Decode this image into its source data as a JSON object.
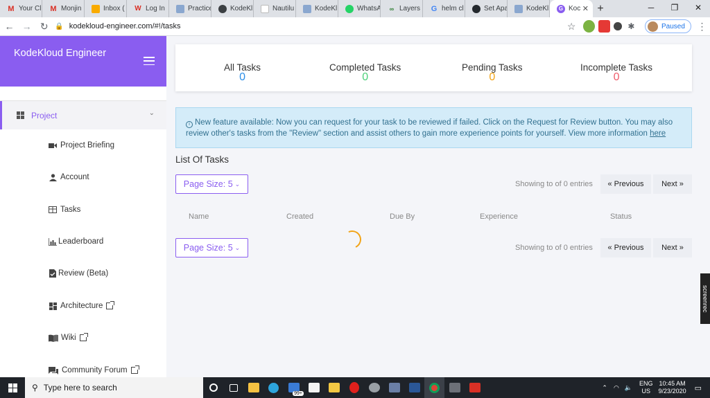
{
  "browser": {
    "tabs": [
      {
        "label": "Your Cl",
        "icon": "gmail-icon",
        "color": "#d93025"
      },
      {
        "label": "Monjin",
        "icon": "gmail-icon",
        "color": "#d93025"
      },
      {
        "label": "Inbox (",
        "icon": "inbox-icon",
        "color": "#f9ab00"
      },
      {
        "label": "Log In",
        "icon": "w-icon",
        "color": "#d93025"
      },
      {
        "label": "Practice",
        "icon": "site-icon",
        "color": "#4a6fa5"
      },
      {
        "label": "KodeKl",
        "icon": "globe-icon",
        "color": "#3c4043"
      },
      {
        "label": "Nautilu",
        "icon": "page-icon",
        "color": "#9aa0a6"
      },
      {
        "label": "KodeKl",
        "icon": "site-icon",
        "color": "#4a6fa5"
      },
      {
        "label": "WhatsA",
        "icon": "whatsapp-icon",
        "color": "#25d366"
      },
      {
        "label": "Layers",
        "icon": "layers-icon",
        "color": "#2e7d32"
      },
      {
        "label": "helm cl",
        "icon": "google-icon",
        "color": "#4285f4"
      },
      {
        "label": "Set Apa",
        "icon": "github-icon",
        "color": "#24292e"
      },
      {
        "label": "KodeKl",
        "icon": "site-icon",
        "color": "#4a6fa5"
      },
      {
        "label": "Koc",
        "icon": "kodekloud-icon",
        "color": "#8a5df0"
      }
    ],
    "url": "kodekloud-engineer.com/#!/tasks",
    "paused_label": "Paused"
  },
  "app": {
    "brand": "KodeKloud Engineer",
    "accent": "#8a5df0",
    "nav": {
      "project": "Project",
      "items": [
        {
          "label": "Project Briefing",
          "icon": "video-camera-icon",
          "external": false
        },
        {
          "label": "Account",
          "icon": "person-icon",
          "external": false
        },
        {
          "label": "Tasks",
          "icon": "table-icon",
          "external": false
        },
        {
          "label": "Leaderboard",
          "icon": "bar-chart-icon",
          "external": false
        },
        {
          "label": "Review (Beta)",
          "icon": "document-check-icon",
          "external": false
        },
        {
          "label": "Architecture",
          "icon": "dashboard-icon",
          "external": true
        },
        {
          "label": "Wiki",
          "icon": "book-icon",
          "external": true
        },
        {
          "label": "Community Forum",
          "icon": "forum-icon",
          "external": true
        }
      ]
    },
    "stats": [
      {
        "label": "All Tasks",
        "value": "0",
        "color": "#2b8ee8"
      },
      {
        "label": "Completed Tasks",
        "value": "0",
        "color": "#4cd17a"
      },
      {
        "label": "Pending Tasks",
        "value": "0",
        "color": "#f2a417"
      },
      {
        "label": "Incomplete Tasks",
        "value": "0",
        "color": "#ef5c6b"
      }
    ],
    "info": {
      "text": "New feature available: Now you can request for your task to be reviewed if failed. Click on the Request for Review button. You may also review other's tasks from the \"Review\" section and assist others to gain more experience points for yourself. View more information ",
      "link": "here"
    },
    "list_title": "List Of Tasks",
    "page_size": "Page Size: 5",
    "showing": "Showing to of 0 entries",
    "previous": "« Previous",
    "next": "Next »",
    "columns": [
      "Name",
      "Created",
      "Due By",
      "Experience",
      "Status"
    ]
  },
  "overlay": {
    "screenrec": "screenrec"
  },
  "taskbar": {
    "search_placeholder": "Type here to search",
    "badge": "99+",
    "lang_top": "ENG",
    "lang_bottom": "US",
    "time": "10:45 AM",
    "date": "9/23/2020"
  }
}
